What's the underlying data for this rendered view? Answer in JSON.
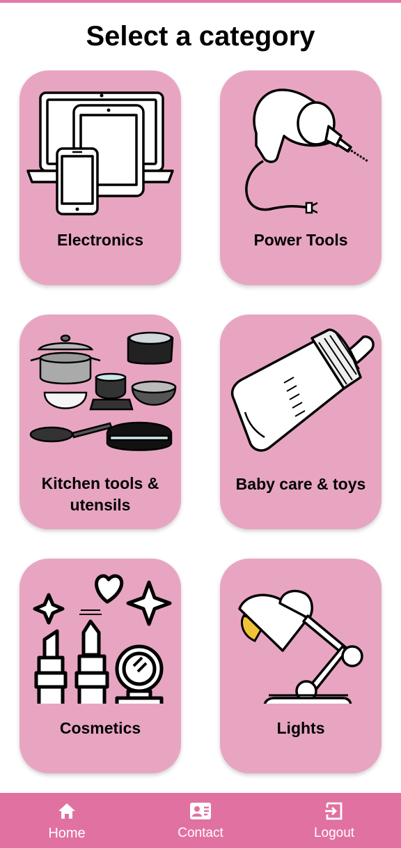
{
  "page": {
    "title": "Select a category"
  },
  "categories": [
    {
      "label": "Electronics",
      "icon": "electronics-devices-icon"
    },
    {
      "label": "Power Tools",
      "icon": "power-drill-icon"
    },
    {
      "label": "Kitchen tools & utensils",
      "label_line1": "Kitchen tools &",
      "label_line2": "utensils",
      "icon": "kitchen-cookware-icon"
    },
    {
      "label": "Baby care & toys",
      "icon": "baby-bottle-icon"
    },
    {
      "label": "Cosmetics",
      "icon": "cosmetics-lipstick-mirror-icon"
    },
    {
      "label": "Lights",
      "icon": "desk-lamp-icon"
    }
  ],
  "nav": {
    "items": [
      {
        "label": "Home",
        "icon": "home-icon",
        "active": true
      },
      {
        "label": "Contact",
        "icon": "contact-card-icon"
      },
      {
        "label": "Logout",
        "icon": "logout-icon"
      }
    ]
  },
  "colors": {
    "accent": "#e171a1",
    "card": "#e8a5c2",
    "text": "#000000",
    "nav_text": "#ffffff"
  }
}
